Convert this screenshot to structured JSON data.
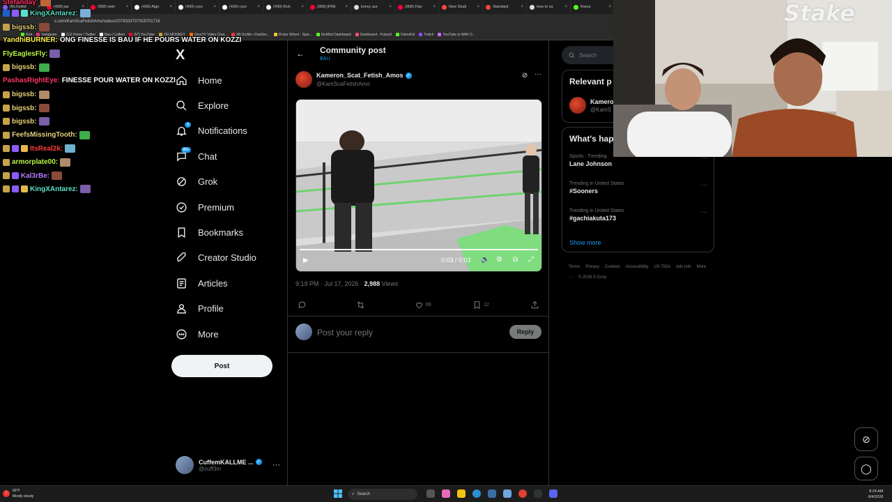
{
  "browser": {
    "tabs": [
      {
        "label": "IRLToolkit",
        "color": "#7b5cff"
      },
      {
        "label": "(438) jae",
        "color": "#ff0033"
      },
      {
        "label": "(958) swin",
        "color": "#ff0033"
      },
      {
        "label": "(439) Algo",
        "color": "#ffffff"
      },
      {
        "label": "(439) ryze",
        "color": "#ffffff"
      },
      {
        "label": "(439) ryze",
        "color": "#ffffff"
      },
      {
        "label": "(439) Kick",
        "color": "#ffffff"
      },
      {
        "label": "(958) [FRE",
        "color": "#ff0033"
      },
      {
        "label": "konvy aur",
        "color": "#dddddd"
      },
      {
        "label": "(958) Flav",
        "color": "#ff0033"
      },
      {
        "label": "New Studi",
        "color": "#ff4444"
      },
      {
        "label": "Standard",
        "color": "#ff4444"
      },
      {
        "label": "how to sa",
        "color": "#dddddd"
      },
      {
        "label": "finess",
        "color": "#53fc18"
      }
    ],
    "url": "x.com/KamScaFetishAmo/status/2078333737918701716",
    "bookmarks": [
      {
        "label": "Kick",
        "color": "#53fc18"
      },
      {
        "label": "Instagram",
        "color": "#e1306c"
      },
      {
        "label": "(12) Home / Twitter",
        "color": "#ffffff"
      },
      {
        "label": "Bau | Cuffem",
        "color": "#ffffff"
      },
      {
        "label": "(57) YouTube",
        "color": "#ff0033"
      },
      {
        "label": "OG MONKEY",
        "color": "#c89b3c"
      },
      {
        "label": "OmeTV Video Chat...",
        "color": "#ff6a00"
      },
      {
        "label": "IRLToolkit • Dashbo...",
        "color": "#ff3333"
      },
      {
        "label": "Picker Wheel - Spin...",
        "color": "#f4c430"
      },
      {
        "label": "KickBot Dashboard",
        "color": "#53fc18"
      },
      {
        "label": "Dashboard - Pulsoid",
        "color": "#ff4d6d"
      },
      {
        "label": "DistroKid",
        "color": "#53fc18"
      },
      {
        "label": "Twitch",
        "color": "#9146ff"
      },
      {
        "label": "YouTube to WAV D...",
        "color": "#cc66ff"
      }
    ]
  },
  "nav": {
    "logo": "X",
    "items": [
      {
        "label": "Home",
        "icon": "home-icon"
      },
      {
        "label": "Explore",
        "icon": "search-icon"
      },
      {
        "label": "Notifications",
        "icon": "bell-icon",
        "badge": "3"
      },
      {
        "label": "Chat",
        "icon": "chat-icon",
        "badge": "20+"
      },
      {
        "label": "Grok",
        "icon": "grok-icon"
      },
      {
        "label": "Premium",
        "icon": "premium-icon"
      },
      {
        "label": "Bookmarks",
        "icon": "bookmark-icon"
      },
      {
        "label": "Creator Studio",
        "icon": "rocket-icon"
      },
      {
        "label": "Articles",
        "icon": "article-icon"
      },
      {
        "label": "Profile",
        "icon": "person-icon"
      },
      {
        "label": "More",
        "icon": "more-circle-icon"
      }
    ],
    "post_label": "Post",
    "account": {
      "name": "CuffemKALLME ...",
      "handle": "@cuff3m"
    }
  },
  "header": {
    "title": "Community post",
    "subtitle": "BAU",
    "back_icon": "arrow-left-icon"
  },
  "post": {
    "author_name": "Kameron_Scat_Fetish_Amos",
    "author_handle": "@KamScaFetishAmo",
    "video": {
      "time": "0:03 / 0:03",
      "progress": 1.0
    },
    "meta_time": "9:19 PM · Jul 17, 2026 · ",
    "views_count": "2,988",
    "views_label": " Views",
    "likes": "65",
    "bookmarks": "12",
    "reply_placeholder": "Post your reply",
    "reply_button": "Reply"
  },
  "sidebar": {
    "search_placeholder": "Search",
    "relevant_title": "Relevant p",
    "relevant_name": "Kamero",
    "relevant_handle": "@KamS",
    "happening_title": "What's hap",
    "trends": [
      {
        "context": "Sports · Trending",
        "name": "Lane Johnson"
      },
      {
        "context": "Trending in United States",
        "name": "#Sooners"
      },
      {
        "context": "Trending in United States",
        "name": "#gachiakuta173"
      }
    ],
    "show_more": "Show more",
    "footer": [
      "Terms",
      "Privacy",
      "Cookies",
      "Accessibility",
      "US TIDA",
      "Ads info",
      "More ···",
      "© 2026 X Corp."
    ]
  },
  "chat": {
    "messages": [
      {
        "user": "YandhiBURNER:",
        "color": "#fff14d",
        "text": "ONG FINESSE IS BAU IF HE POURS WATER ON KOZZI",
        "badges": 0,
        "emote": false
      },
      {
        "user": "FlyEaglesFly:",
        "color": "#b6f542",
        "text": "",
        "badges": 0,
        "emote": true
      },
      {
        "user": "bigssb:",
        "color": "#e6cf7a",
        "text": "",
        "badges": 1,
        "emote": true
      },
      {
        "user": "PashasRightEye:",
        "color": "#ff3366",
        "text": "FINESSE POUR WATER ON KOZZI",
        "badges": 0,
        "emote": false
      },
      {
        "user": "bigssb:",
        "color": "#e6cf7a",
        "text": "",
        "badges": 1,
        "emote": true
      },
      {
        "user": "bigssb:",
        "color": "#e6cf7a",
        "text": "",
        "badges": 1,
        "emote": true
      },
      {
        "user": "bigssb:",
        "color": "#e6cf7a",
        "text": "",
        "badges": 1,
        "emote": true
      },
      {
        "user": "FeefsMissingTooth:",
        "color": "#e6cf7a",
        "text": "",
        "badges": 1,
        "emote": true
      },
      {
        "user": "ItsReal2k:",
        "color": "#ff3b3b",
        "text": "",
        "badges": 3,
        "emote": true
      },
      {
        "user": "armorplate00:",
        "color": "#b6f542",
        "text": "",
        "badges": 1,
        "emote": true
      },
      {
        "user": "Kal3rBe:",
        "color": "#b07bff",
        "text": "",
        "badges": 2,
        "emote": true
      },
      {
        "user": "KingXAntarez:",
        "color": "#5ce1c7",
        "text": "",
        "badges": 3,
        "emote": true
      }
    ],
    "top_cut_line": "KingXAntarez:",
    "top_cut_line2": "bigssb:"
  },
  "overlay": {
    "stake_logo": "Stake"
  },
  "taskbar": {
    "weather_temp": "66°F",
    "weather_desc": "Mostly cloudy",
    "search_label": "Search",
    "time": "8:24 AM",
    "date": "8/4/2026"
  },
  "colors": {
    "accent": "#1d9bf0",
    "bg": "#000000",
    "border": "#2f3336",
    "muted": "#71767b"
  }
}
